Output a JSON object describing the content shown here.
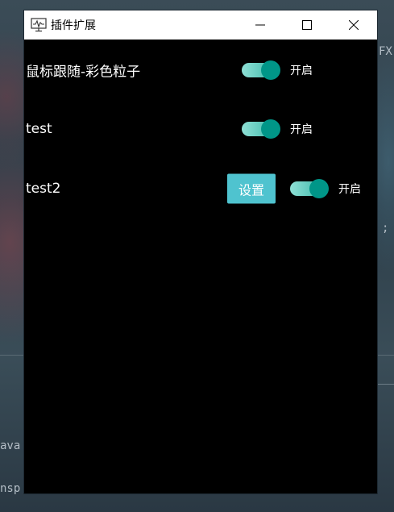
{
  "background": {
    "left_fragment_1": "ava",
    "left_fragment_2": "nsp",
    "right_fragment_1": "FX",
    "right_fragment_2": ";"
  },
  "window": {
    "title": "插件扩展",
    "app_icon": "monitor-pulse-icon",
    "controls": {
      "minimize_icon": "minimize-icon",
      "maximize_icon": "maximize-icon",
      "close_icon": "close-icon"
    }
  },
  "plugins": [
    {
      "name": "鼠标跟随-彩色粒子",
      "enabled": true,
      "toggle_label": "开启",
      "settings_label": ""
    },
    {
      "name": "test",
      "enabled": true,
      "toggle_label": "开启",
      "settings_label": ""
    },
    {
      "name": "test2",
      "enabled": true,
      "toggle_label": "开启",
      "settings_label": "设置"
    }
  ],
  "colors": {
    "toggle_knob": "#009688",
    "toggle_track": "#52c2b4",
    "settings_button": "#4fc3cf",
    "window_background": "#000000"
  }
}
